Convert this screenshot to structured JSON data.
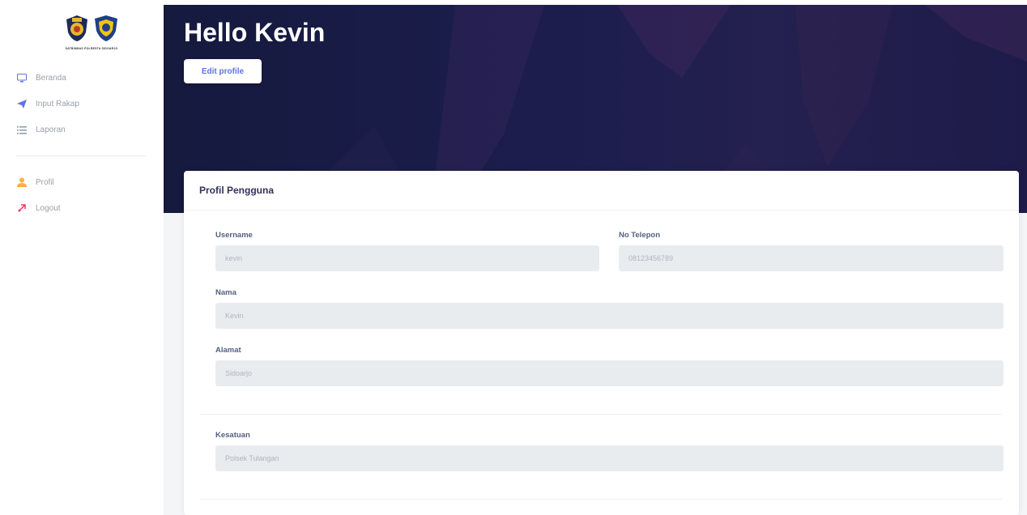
{
  "sidebar": {
    "logo_text": "SATBINMAS POLRESTA SIDOARJO",
    "items": [
      {
        "label": "Beranda",
        "icon": "monitor-icon",
        "color": "#5e72e4"
      },
      {
        "label": "Input Rakap",
        "icon": "send-icon",
        "color": "#5e72e4"
      },
      {
        "label": "Laporan",
        "icon": "list-icon",
        "color": "#8898aa"
      },
      {
        "label": "Profil",
        "icon": "user-icon",
        "color": "#fb6340"
      },
      {
        "label": "Logout",
        "icon": "logout-icon",
        "color": "#f5365c"
      }
    ]
  },
  "header": {
    "greeting": "Hello Kevin",
    "edit_button": "Edit profile"
  },
  "card": {
    "title": "Profil Pengguna",
    "fields": {
      "username": {
        "label": "Username",
        "value": "kevin"
      },
      "phone": {
        "label": "No Telepon",
        "value": "08123456789"
      },
      "name": {
        "label": "Nama",
        "value": "Kevin"
      },
      "address": {
        "label": "Alamat",
        "value": "Sidoarjo"
      },
      "unit": {
        "label": "Kesatuan",
        "value": "Polsek Tulangan"
      }
    }
  },
  "colors": {
    "accent": "#5e72e4",
    "hero_bg": "#1c1d4d"
  }
}
